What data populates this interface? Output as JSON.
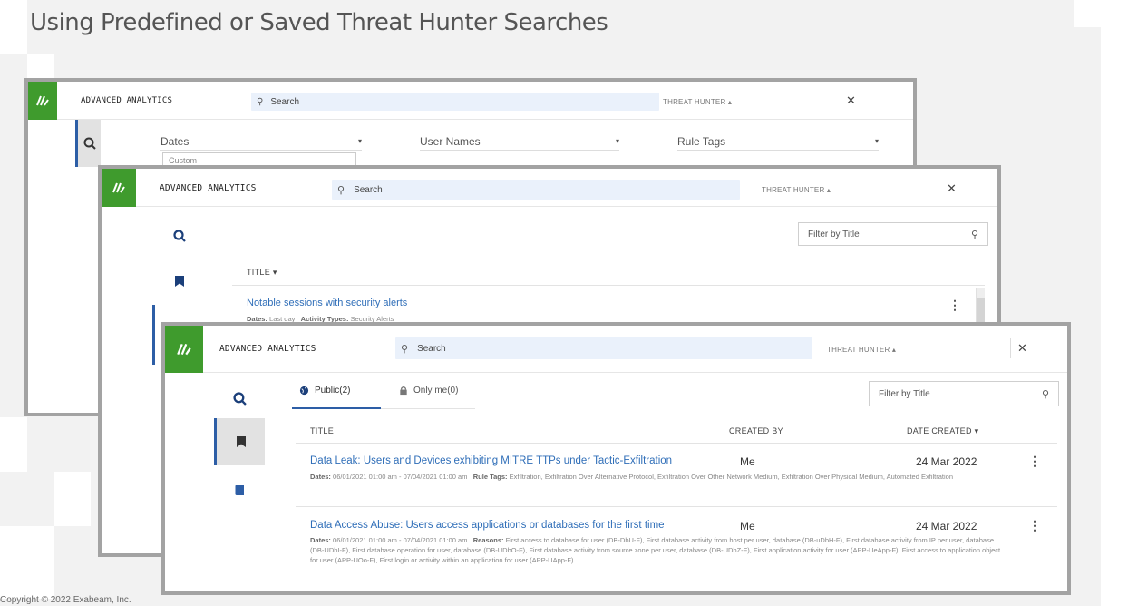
{
  "slide": {
    "title": "Using Predefined or Saved Threat Hunter Searches",
    "copyright": "Copyright © 2022 Exabeam, Inc."
  },
  "colors": {
    "brand_green": "#3f9b2d",
    "link_blue": "#2f6eb8",
    "active_border": "#2d5ea6",
    "frame_gray": "#a3a3a3"
  },
  "app": {
    "brand": "ADVANCED ANALYTICS",
    "search_placeholder": "Search",
    "mode_label": "THREAT HUNTER",
    "close_glyph": "✕"
  },
  "back_window": {
    "fields": [
      {
        "label": "Dates",
        "arrow": "▾"
      },
      {
        "label": "User Names",
        "arrow": "▾"
      },
      {
        "label": "Rule Tags",
        "arrow": "▾"
      }
    ],
    "date_select_value": "Custom"
  },
  "middle_window": {
    "filter_placeholder": "Filter by Title",
    "column_title": "TITLE",
    "sort_glyph": "▾",
    "rows": [
      {
        "title": "Notable sessions with security alerts",
        "meta_dates_label": "Dates:",
        "meta_dates_value": "Last day",
        "meta_types_label": "Activity Types:",
        "meta_types_value": "Security Alerts"
      }
    ]
  },
  "front_window": {
    "tabs": [
      {
        "label": "Public(2)",
        "icon": "globe-icon"
      },
      {
        "label": "Only me(0)",
        "icon": "lock-icon"
      }
    ],
    "filter_placeholder": "Filter by Title",
    "columns": {
      "title": "TITLE",
      "created_by": "CREATED BY",
      "date_created": "DATE CREATED",
      "sort_glyph": "▾"
    },
    "rows": [
      {
        "title": "Data Leak: Users and Devices exhibiting MITRE TTPs under Tactic-Exfiltration",
        "created_by": "Me",
        "date_created": "24 Mar 2022",
        "dates_label": "Dates:",
        "dates_value": "06/01/2021 01:00 am - 07/04/2021 01:00 am",
        "tags_label": "Rule Tags:",
        "tags_value": "Exfiltration, Exfiltration Over Alternative Protocol, Exfiltration Over Other Network Medium, Exfiltration Over Physical Medium, Automated Exfiltration"
      },
      {
        "title": "Data Access Abuse: Users access applications or databases for the first time",
        "created_by": "Me",
        "date_created": "24 Mar 2022",
        "dates_label": "Dates:",
        "dates_value": "06/01/2021 01:00 am - 07/04/2021 01:00 am",
        "reasons_label": "Reasons:",
        "reasons_value": "First access to database for user (DB-DbU-F), First database activity from host per user, database (DB-uDbH-F), First database activity from IP per user, database (DB-UDbI-F), First database operation for user, database (DB-UDbO-F), First database activity from source zone per user, database (DB-UDbZ-F), First application activity for user (APP-UeApp-F), First access to application object for user (APP-UOo-F), First login or activity within an application for user (APP-UApp-F)"
      }
    ],
    "kebab_glyph": "⋮"
  }
}
